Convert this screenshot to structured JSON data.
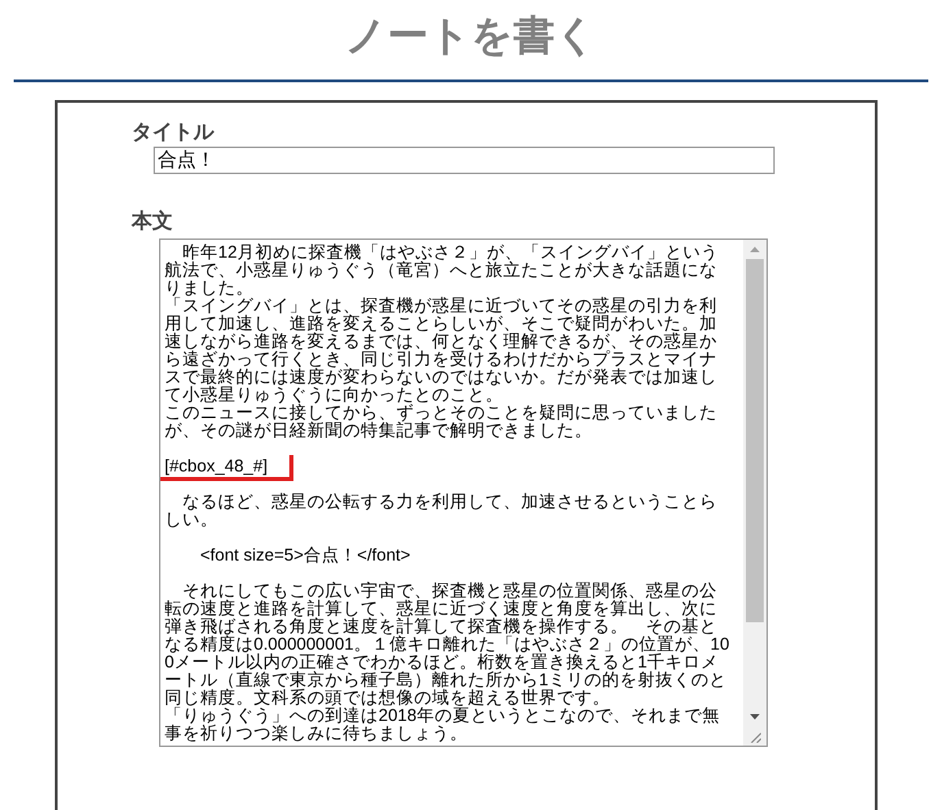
{
  "page": {
    "title": "ノートを書く"
  },
  "form": {
    "title_label": "タイトル",
    "title_value": "合点！",
    "body_label": "本文",
    "body_blocks": [
      [
        "　昨年12月初めに探査機「はやぶさ２」が、「スイングバイ」という",
        "航法で、小惑星りゅうぐう（竜宮）へと旅立たことが大きな話題にな",
        "りました。",
        "「スイングバイ」とは、探査機が惑星に近づいてその惑星の引力を利",
        "用して加速し、進路を変えることらしいが、そこで疑問がわいた。加",
        "速しながら進路を変えるまでは、何となく理解できるが、その惑星か",
        "ら遠ざかって行くとき、同じ引力を受けるわけだからプラスとマイナ",
        "スで最終的には速度が変わらないのではないか。だが発表では加速し",
        "て小惑星りゅうぐうに向かったとのこと。",
        "このニュースに接してから、ずっとそのことを疑問に思っていました",
        "が、その謎が日経新聞の特集記事で解明できました。"
      ],
      [
        "[#cbox_48_#]"
      ],
      [
        "　なるほど、惑星の公転する力を利用して、加速させるということら",
        "しい。"
      ],
      [
        "　　<font size=5>合点！</font>"
      ],
      [
        "　それにしてもこの広い宇宙で、探査機と惑星の位置関係、惑星の公",
        "転の速度と進路を計算して、惑星に近づく速度と角度を算出し、次に",
        "弾き飛ばされる角度と速度を計算して探査機を操作する。　その基と",
        "なる精度は0.000000001。１億キロ離れた「はやぶさ２」の位置が、10",
        "0メートル以内の正確さでわかるほど。桁数を置き換えると1千キロメ",
        "ートル（直線で東京から種子島）離れた所から1ミリの的を射抜くのと",
        "同じ精度。文科系の頭では想像の域を超える世界です。",
        "「りゅうぐう」への到達は2018年の夏というとこなので、それまで無",
        "事を祈りつつ楽しみに待ちましょう。"
      ]
    ]
  }
}
